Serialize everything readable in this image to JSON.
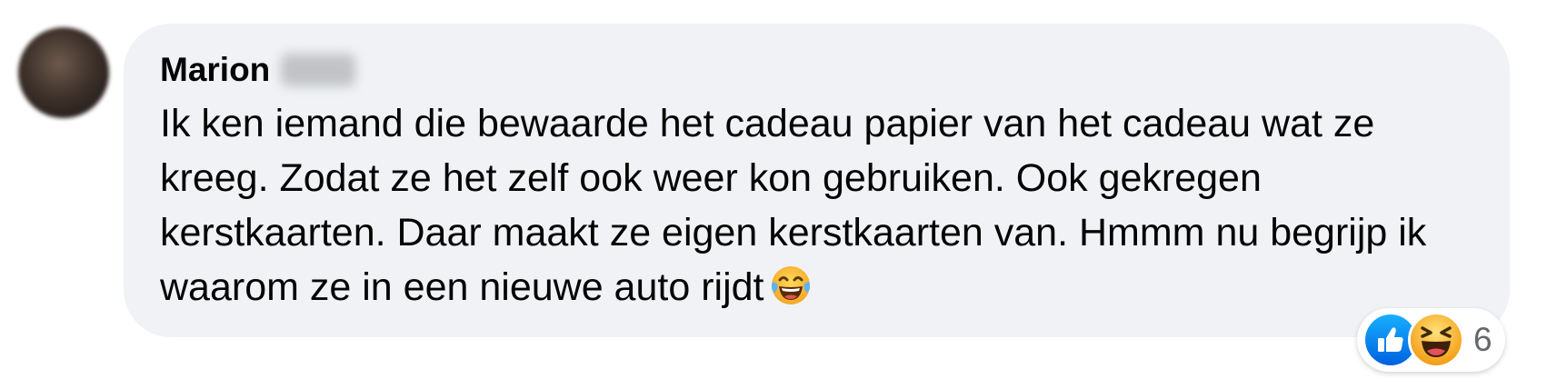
{
  "comment": {
    "author": {
      "first_name": "Marion",
      "avatar_icon": "user-avatar-blurred"
    },
    "text": "Ik ken iemand die bewaarde het cadeau papier van het cadeau wat ze kreeg. Zodat ze het zelf ook weer kon gebruiken. Ook gekregen kerstkaarten. Daar maakt ze eigen kerstkaarten van. Hmmm nu begrijp ik waarom ze in een nieuwe auto rijdt",
    "emoji_icon": "face-with-tears-of-joy-icon",
    "reactions": {
      "icons": [
        "like-icon",
        "haha-icon"
      ],
      "count": "6",
      "colors": {
        "like": "#1877f2",
        "haha": "#f7b125"
      }
    },
    "colors": {
      "bubble": "#f0f2f5",
      "text": "#050505",
      "count": "#65676b"
    }
  }
}
